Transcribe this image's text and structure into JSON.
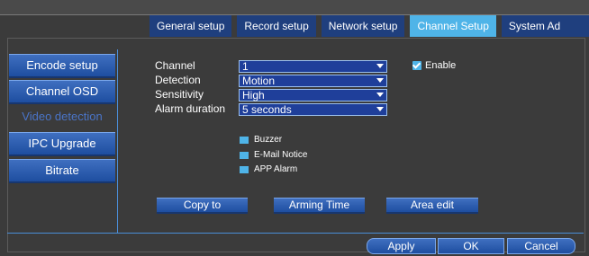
{
  "tabs": [
    {
      "label": "General setup"
    },
    {
      "label": "Record setup"
    },
    {
      "label": "Network setup"
    },
    {
      "label": "Channel Setup",
      "active": true
    },
    {
      "label": "System Admin"
    }
  ],
  "sidebar": {
    "items": [
      {
        "label": "Encode setup"
      },
      {
        "label": "Channel OSD"
      },
      {
        "label": "Video detection",
        "disabled": true
      },
      {
        "label": "IPC Upgrade"
      },
      {
        "label": "Bitrate"
      }
    ]
  },
  "form": {
    "channel": {
      "label": "Channel",
      "value": "1"
    },
    "detection": {
      "label": "Detection",
      "value": "Motion"
    },
    "sensitivity": {
      "label": "Sensitivity",
      "value": "High"
    },
    "alarm_duration": {
      "label": "Alarm duration",
      "value": "5 seconds"
    },
    "enable": {
      "label": "Enable",
      "checked": true
    }
  },
  "alarm_options": [
    {
      "label": "Buzzer"
    },
    {
      "label": "E-Mail Notice"
    },
    {
      "label": "APP Alarm"
    }
  ],
  "actions": {
    "copy_to": "Copy to",
    "arming_time": "Arming Time",
    "area_edit": "Area edit"
  },
  "footer": {
    "apply": "Apply",
    "ok": "OK",
    "cancel": "Cancel"
  },
  "colors": {
    "accent": "#4fb4e8",
    "button": "#1f3f9a",
    "tab": "#1f3f7e",
    "background": "#3b3b3b"
  }
}
